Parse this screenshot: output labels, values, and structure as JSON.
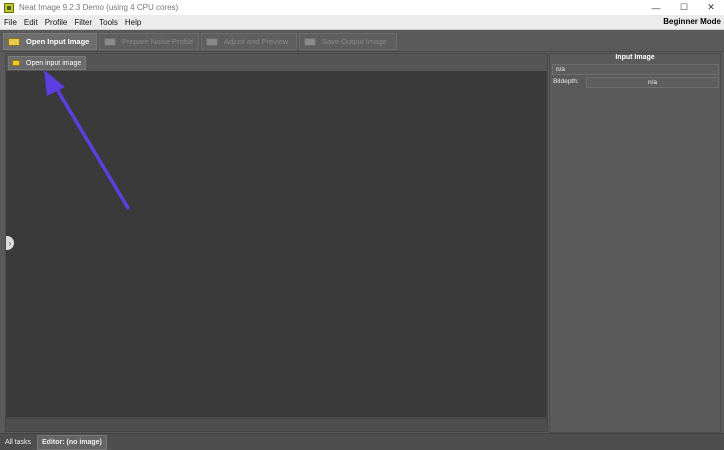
{
  "window": {
    "title": "Neat Image 9.2.3 Demo (using 4 CPU cores)",
    "minimize": "—",
    "maximize": "☐",
    "close": "✕"
  },
  "menu": {
    "items": [
      "File",
      "Edit",
      "Profile",
      "Filter",
      "Tools",
      "Help"
    ],
    "mode": "Beginner Mode"
  },
  "tabs": [
    {
      "label": "Open Input Image",
      "icon": "camera-icon",
      "active": true
    },
    {
      "label": "Prepare Noise Profile",
      "icon": "profile-icon",
      "active": false
    },
    {
      "label": "Adjust and Preview",
      "icon": "preview-icon",
      "active": false
    },
    {
      "label": "Save Output Image",
      "icon": "save-icon",
      "active": false
    }
  ],
  "editor": {
    "open_button_label": "Open input image",
    "open_button_icon": "folder-icon"
  },
  "input_panel": {
    "title": "Input Image",
    "name_value": "n/a",
    "bitdepth_label": "Bitdepth:",
    "bitdepth_value": "n/a"
  },
  "bottom_tabs": [
    {
      "label": "All tasks",
      "active": false
    },
    {
      "label": "Editor: (no image)",
      "active": true
    }
  ],
  "colors": {
    "arrow": "#5b3fe0",
    "accent_yellow": "#e8c84a",
    "background": "#5a5a5a"
  },
  "expand_handle": "›"
}
